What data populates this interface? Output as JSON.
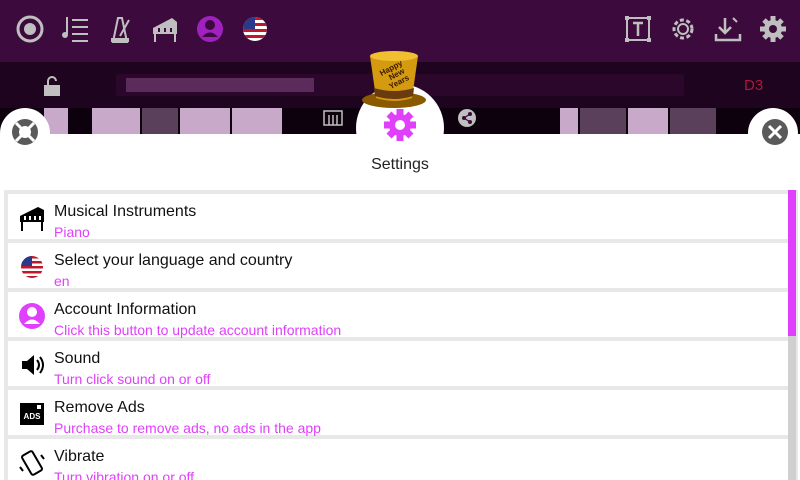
{
  "toolbar": {
    "icons": [
      "record-icon",
      "playlist-icon",
      "metronome-icon",
      "piano-icon",
      "account-icon",
      "us-flag-icon",
      "text-icon",
      "settings-gear-icon",
      "download-icon",
      "settings-icon"
    ]
  },
  "subbar": {
    "note": "D3"
  },
  "overlay": {
    "hat_text": "Happy New Years"
  },
  "settings": {
    "title": "Settings",
    "items": [
      {
        "title": "Musical Instruments",
        "subtitle": "Piano",
        "icon": "piano-icon"
      },
      {
        "title": "Select your language and country",
        "subtitle": "en",
        "icon": "us-flag-icon"
      },
      {
        "title": "Account Information",
        "subtitle": "Click this button to update account information",
        "icon": "account-icon"
      },
      {
        "title": "Sound",
        "subtitle": "Turn click sound on or off",
        "icon": "speaker-icon"
      },
      {
        "title": "Remove Ads",
        "subtitle": "Purchase to remove ads, no ads in the app",
        "icon": "ads-icon"
      },
      {
        "title": "Vibrate",
        "subtitle": "Turn vibration on or off",
        "icon": "vibrate-icon"
      }
    ]
  },
  "colors": {
    "accent": "#e040fb",
    "topbar": "#3c0a3c",
    "note": "#b0183a"
  }
}
